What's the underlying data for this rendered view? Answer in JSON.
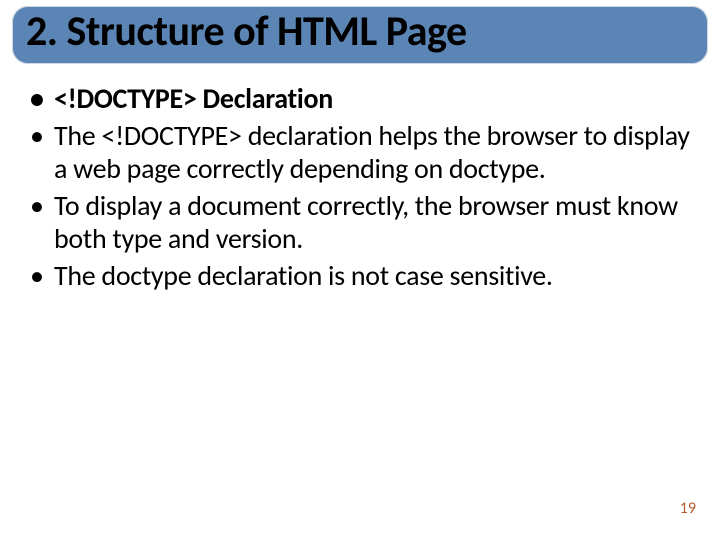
{
  "slide": {
    "title": "2. Structure of HTML Page",
    "bullets": [
      {
        "text": "<!DOCTYPE> Declaration",
        "bold": true
      },
      {
        "text": "The <!DOCTYPE> declaration helps the browser to display a web page correctly depending on doctype.",
        "bold": false
      },
      {
        "text": "To display a document correctly, the browser must know both type and version.",
        "bold": false
      },
      {
        "text": "The doctype declaration is not case sensitive.",
        "bold": false
      }
    ],
    "page_number": "19"
  }
}
